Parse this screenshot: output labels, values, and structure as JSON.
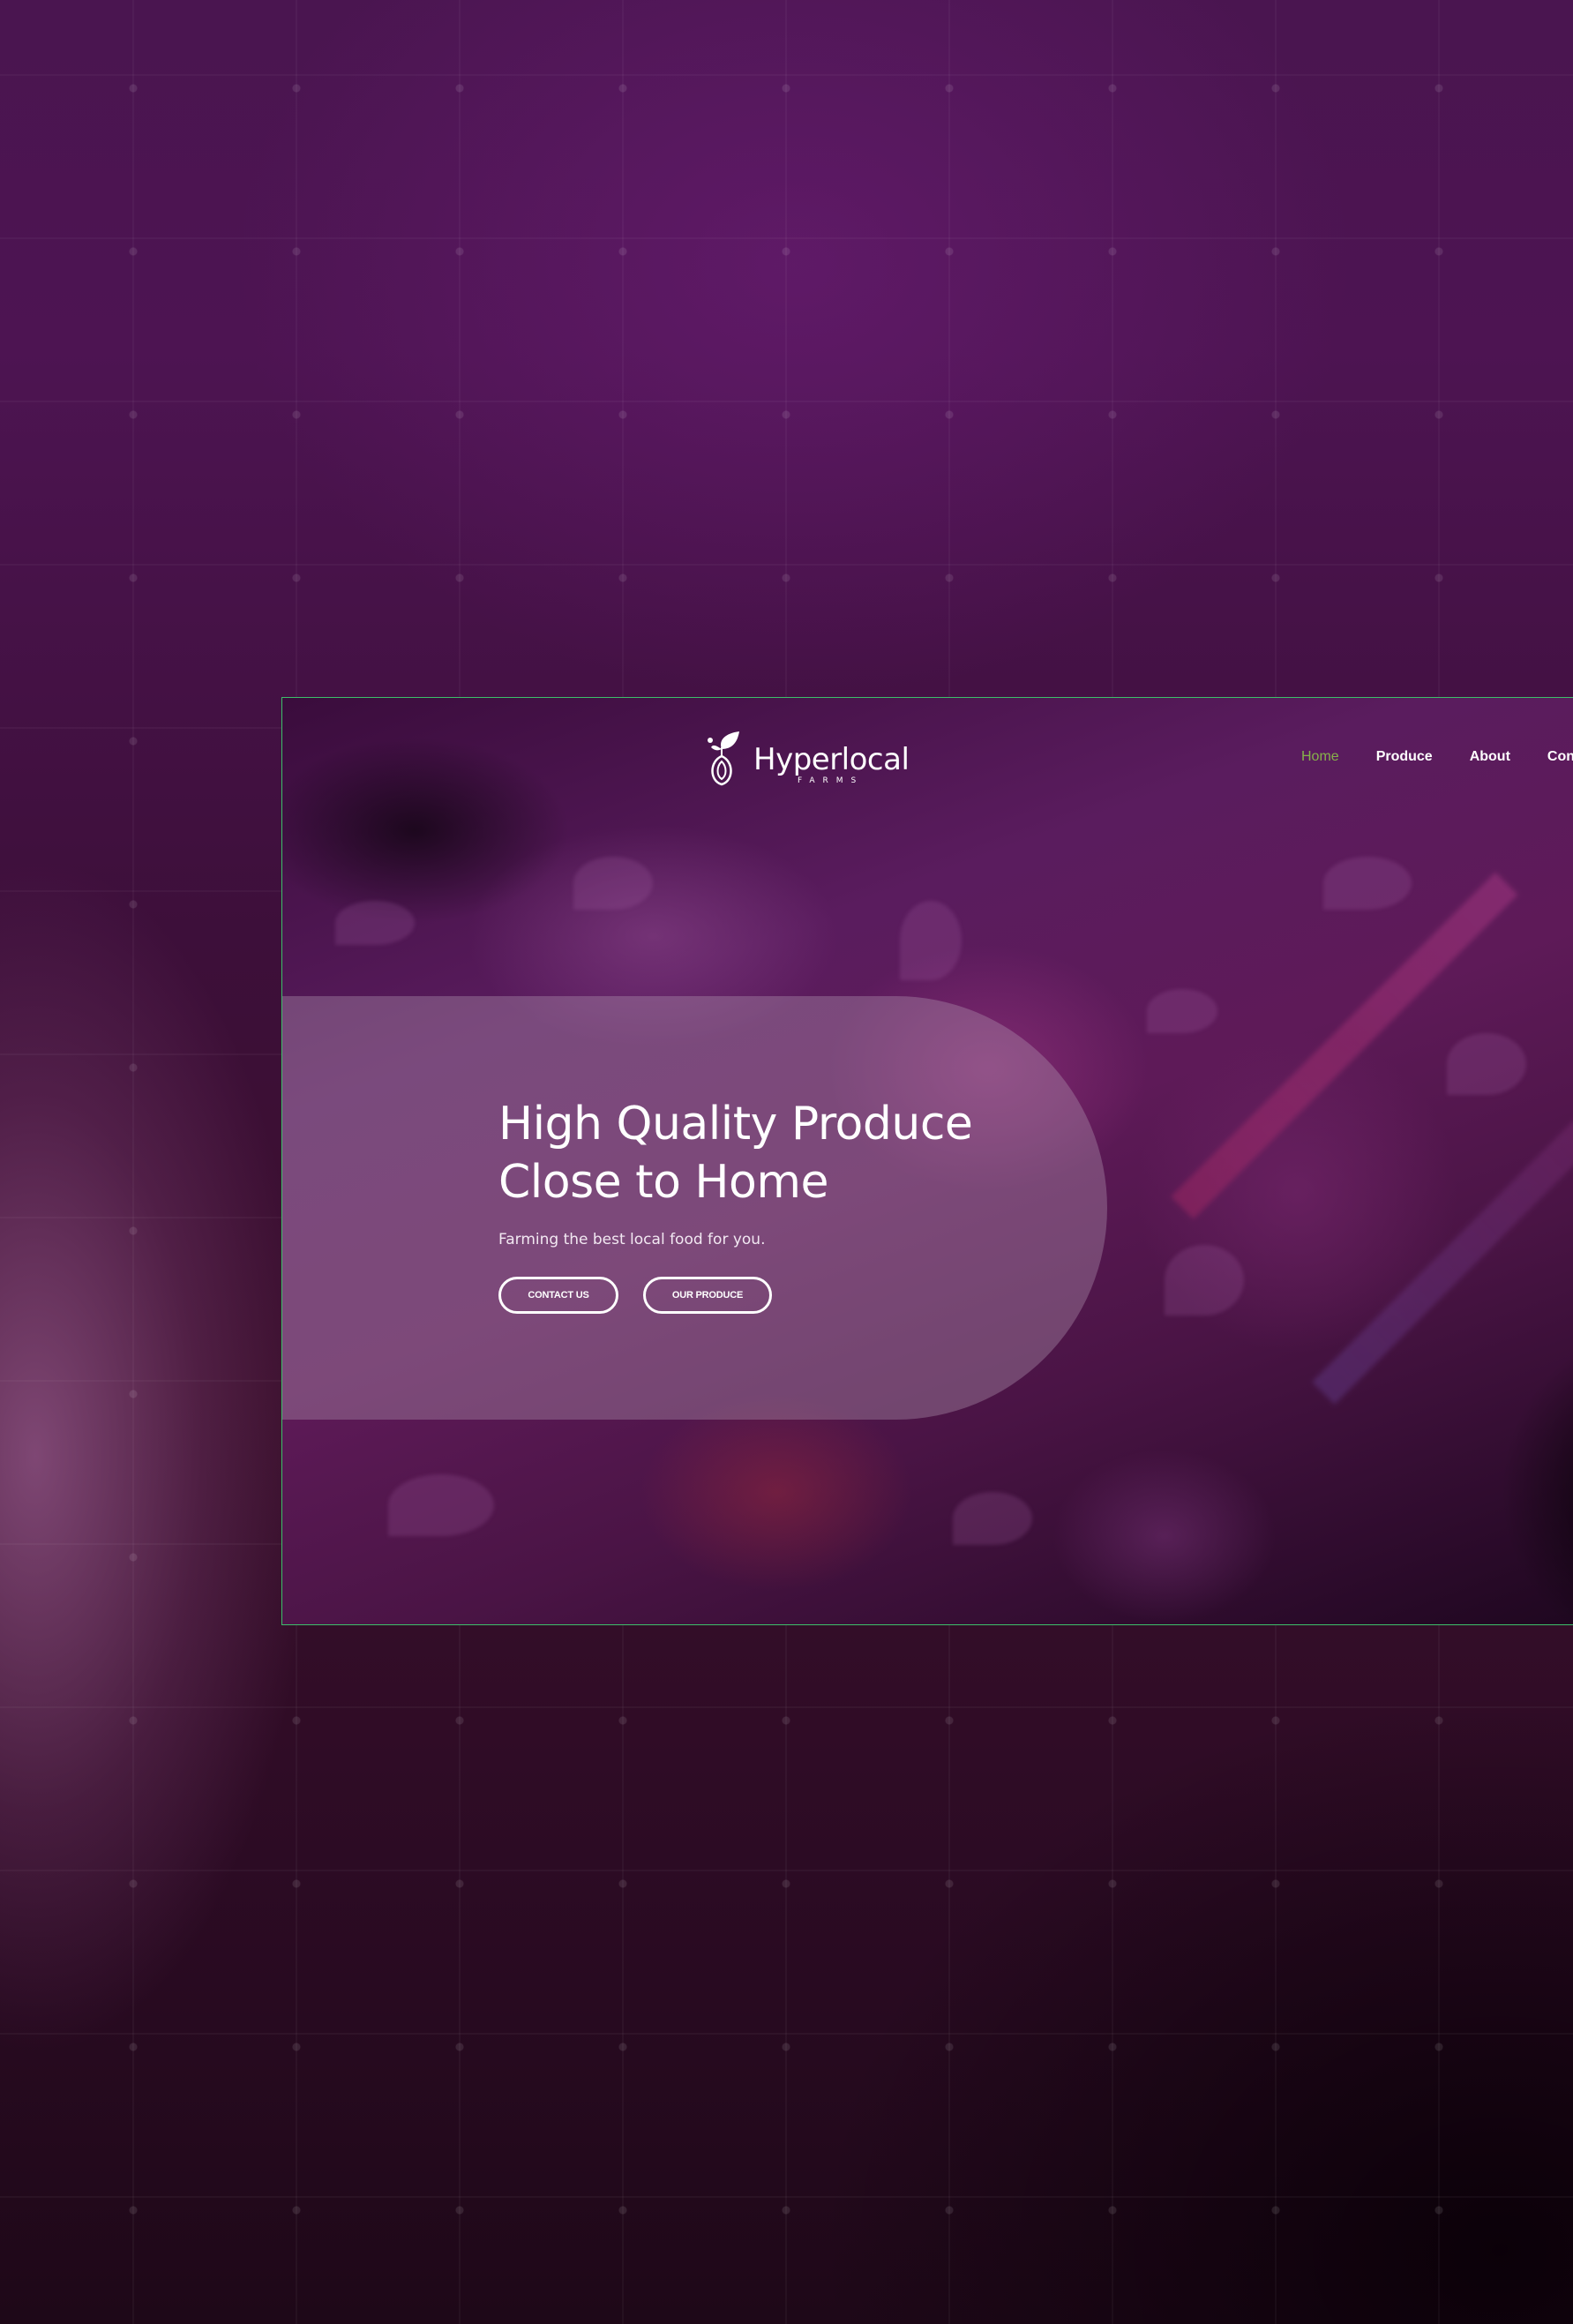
{
  "brand": {
    "name": "Hyperlocal",
    "tagline": "FARMS"
  },
  "nav": {
    "items": [
      {
        "label": "Home",
        "active": true
      },
      {
        "label": "Produce",
        "active": false
      },
      {
        "label": "About",
        "active": false
      },
      {
        "label": "Cont",
        "active": false
      }
    ]
  },
  "hero": {
    "title_line1": "High Quality Produce",
    "title_line2": "Close to Home",
    "subtitle": "Farming the best local food for you.",
    "buttons": {
      "contact": "CONTACT US",
      "produce": "OUR PRODUCE"
    }
  },
  "colors": {
    "accent_active_nav": "#86b24a",
    "frame_border": "#3dbf6a",
    "background": "#4a1550"
  }
}
